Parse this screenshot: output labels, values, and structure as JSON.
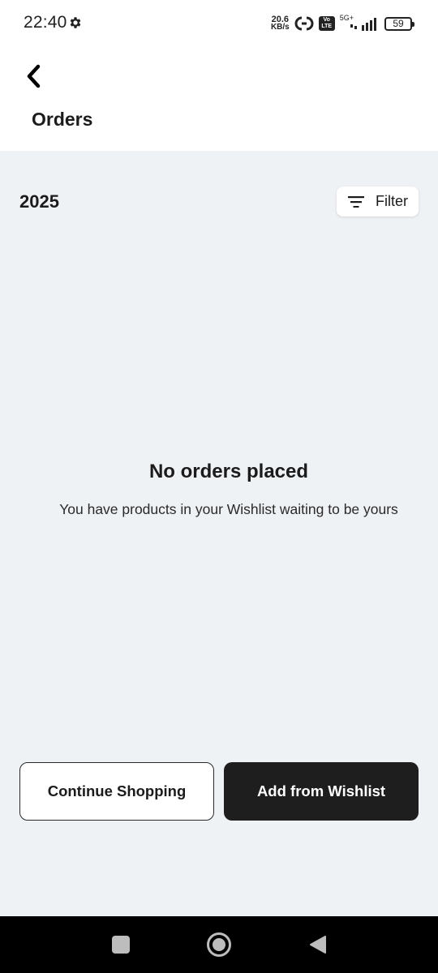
{
  "status_bar": {
    "time": "22:40",
    "net_speed_value": "20.6",
    "net_speed_unit": "KB/s",
    "volte_top": "Vo",
    "volte_bottom": "LTE",
    "network_type": "5G+",
    "battery_level": "59",
    "icons": [
      "gear-icon",
      "hotspot-icon",
      "volte-icon",
      "signal-icon",
      "battery-icon"
    ]
  },
  "header": {
    "back_icon": "chevron-left-icon",
    "title": "Orders"
  },
  "content": {
    "year": "2025",
    "filter": {
      "icon": "filter-lines-icon",
      "label": "Filter"
    },
    "empty_state": {
      "title": "No orders placed",
      "subtitle": "You have products in your Wishlist waiting to be yours"
    },
    "actions": {
      "continue_label": "Continue Shopping",
      "wishlist_label": "Add from Wishlist"
    }
  },
  "nav_bar": {
    "icons": [
      "recents-icon",
      "home-icon",
      "back-triangle-icon"
    ]
  },
  "colors": {
    "background": "#eff2f5",
    "header_background": "#ffffff",
    "primary_button": "#1e1e1e",
    "text": "#1b1b1b"
  }
}
